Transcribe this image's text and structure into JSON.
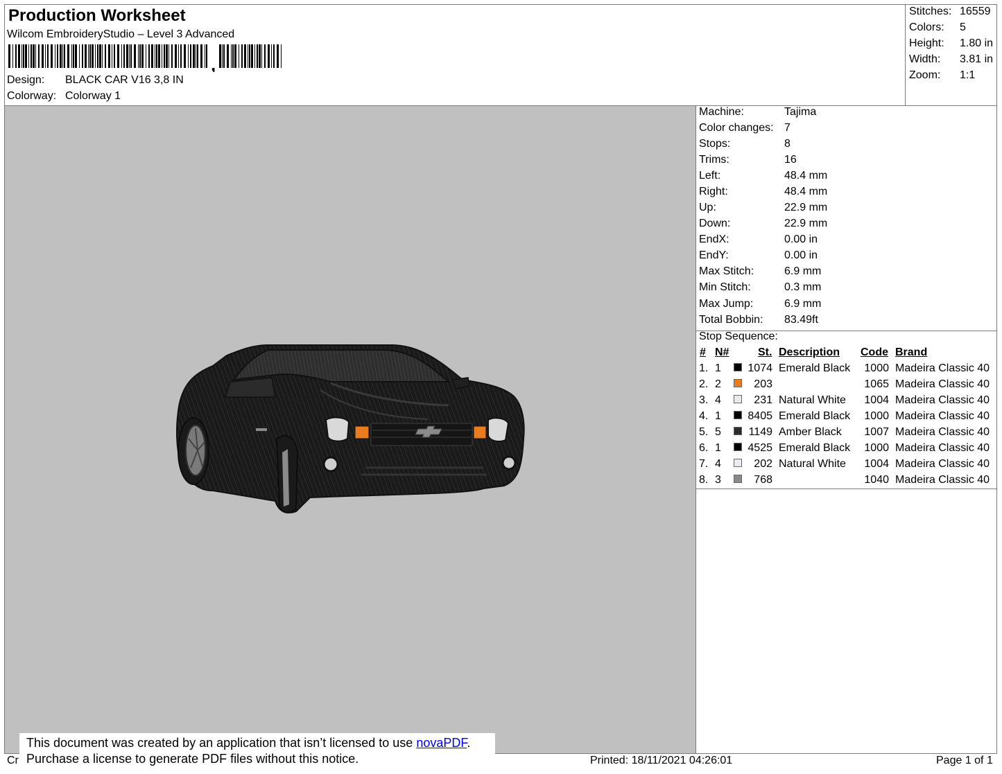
{
  "header": {
    "title": "Production Worksheet",
    "subtitle": "Wilcom EmbroideryStudio – Level 3 Advanced",
    "barcode_separator": ",",
    "design_label": "Design:",
    "design_value": "BLACK CAR V16 3,8 IN",
    "colorway_label": "Colorway:",
    "colorway_value": "Colorway 1"
  },
  "stats": [
    {
      "label": "Stitches:",
      "value": "16559"
    },
    {
      "label": "Colors:",
      "value": "5"
    },
    {
      "label": "Height:",
      "value": "1.80 in"
    },
    {
      "label": "Width:",
      "value": "3.81 in"
    },
    {
      "label": "Zoom:",
      "value": "1:1"
    }
  ],
  "machine_info": [
    {
      "label": "Machine:",
      "value": "Tajima"
    },
    {
      "label": "Color changes:",
      "value": "7"
    },
    {
      "label": "Stops:",
      "value": "8"
    },
    {
      "label": "Trims:",
      "value": "16"
    },
    {
      "label": "Left:",
      "value": "48.4 mm"
    },
    {
      "label": "Right:",
      "value": "48.4 mm"
    },
    {
      "label": "Up:",
      "value": "22.9 mm"
    },
    {
      "label": "Down:",
      "value": "22.9 mm"
    },
    {
      "label": "EndX:",
      "value": "0.00 in"
    },
    {
      "label": "EndY:",
      "value": "0.00 in"
    },
    {
      "label": "Max Stitch:",
      "value": "6.9 mm"
    },
    {
      "label": "Min Stitch:",
      "value": "0.3 mm"
    },
    {
      "label": "Max Jump:",
      "value": "6.9 mm"
    },
    {
      "label": "Total Bobbin:",
      "value": "83.49ft"
    }
  ],
  "stop_sequence": {
    "label": "Stop Sequence:",
    "headers": {
      "num": "#",
      "needle": "N#",
      "stitches": "St.",
      "description": "Description",
      "code": "Code",
      "brand": "Brand"
    },
    "rows": [
      {
        "num": "1.",
        "needle": "1",
        "color": "#000000",
        "stitches": "1074",
        "description": "Emerald Black",
        "code": "1000",
        "brand": "Madeira Classic 40"
      },
      {
        "num": "2.",
        "needle": "2",
        "color": "#e87c1e",
        "stitches": "203",
        "description": "",
        "code": "1065",
        "brand": "Madeira Classic 40"
      },
      {
        "num": "3.",
        "needle": "4",
        "color": "#ececf0",
        "stitches": "231",
        "description": "Natural White",
        "code": "1004",
        "brand": "Madeira Classic 40"
      },
      {
        "num": "4.",
        "needle": "1",
        "color": "#000000",
        "stitches": "8405",
        "description": "Emerald Black",
        "code": "1000",
        "brand": "Madeira Classic 40"
      },
      {
        "num": "5.",
        "needle": "5",
        "color": "#2b2b2b",
        "stitches": "1149",
        "description": "Amber Black",
        "code": "1007",
        "brand": "Madeira Classic 40"
      },
      {
        "num": "6.",
        "needle": "1",
        "color": "#000000",
        "stitches": "4525",
        "description": "Emerald Black",
        "code": "1000",
        "brand": "Madeira Classic 40"
      },
      {
        "num": "7.",
        "needle": "4",
        "color": "#ececf0",
        "stitches": "202",
        "description": "Natural White",
        "code": "1004",
        "brand": "Madeira Classic 40"
      },
      {
        "num": "8.",
        "needle": "3",
        "color": "#8a8a8a",
        "stitches": "768",
        "description": "",
        "code": "1040",
        "brand": "Madeira Classic 40"
      }
    ]
  },
  "footer": {
    "cr_text": "Cr",
    "printed": "Printed: 18/11/2021 04:26:01",
    "page": "Page 1 of 1"
  },
  "notice": {
    "line1_prefix": "This document was created by an application that isn’t licensed to use ",
    "link_text": "novaPDF",
    "line1_suffix": ".",
    "line2": "Purchase a license to generate PDF files without this notice."
  },
  "colors": {
    "preview_bg": "#c0c0c0",
    "border": "#7a7a7a",
    "link": "#0000ee"
  }
}
